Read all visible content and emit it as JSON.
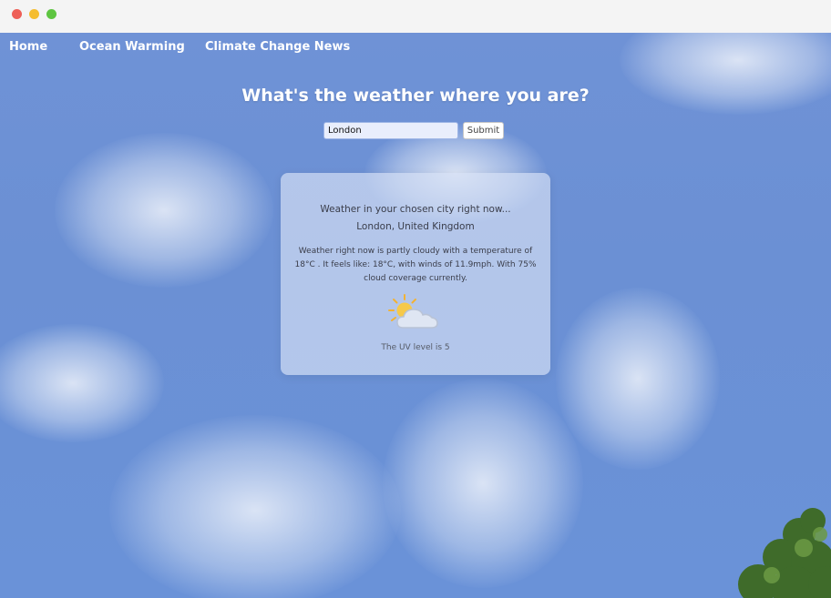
{
  "nav": {
    "items": [
      {
        "label": "Home"
      },
      {
        "label": "Ocean Warming"
      },
      {
        "label": "Climate Change News"
      }
    ]
  },
  "page_title": "What's the weather where you are?",
  "search": {
    "value": "London",
    "submit_label": "Submit"
  },
  "weather": {
    "heading": "Weather in your chosen city right now...",
    "location": "London, United Kingdom",
    "description": "Weather right now is partly cloudy with a temperature of 18°C . It feels like: 18°C, with winds of 11.9mph. With 75% cloud coverage currently.",
    "icon": "partly-cloudy-icon",
    "uv_text": "The UV level is 5"
  },
  "colors": {
    "sky": "#6b90d4",
    "card": "#d6e0f4"
  }
}
